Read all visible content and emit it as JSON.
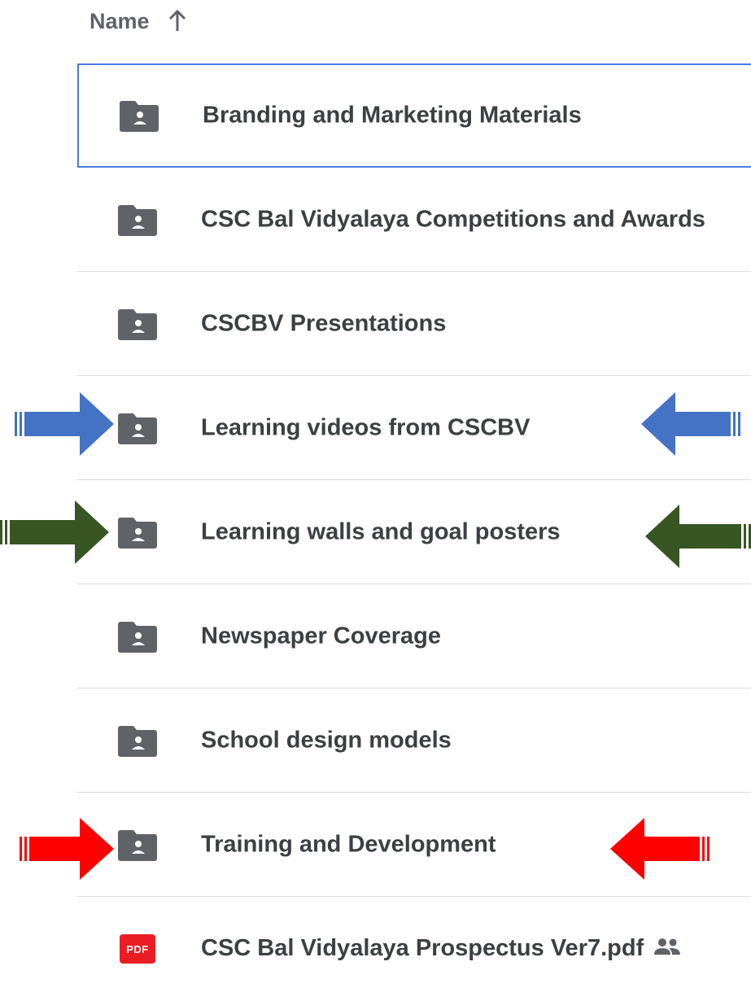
{
  "header": {
    "name_label": "Name",
    "sort_icon": "arrow-up-icon"
  },
  "files": [
    {
      "label": "Branding and Marketing Materials",
      "type": "shared-folder",
      "icon": "shared-folder-icon",
      "selected": true
    },
    {
      "label": "CSC Bal Vidyalaya Competitions and Awards",
      "type": "shared-folder",
      "icon": "shared-folder-icon",
      "selected": false
    },
    {
      "label": "CSCBV Presentations",
      "type": "shared-folder",
      "icon": "shared-folder-icon",
      "selected": false
    },
    {
      "label": "Learning videos from CSCBV",
      "type": "shared-folder",
      "icon": "shared-folder-icon",
      "selected": false
    },
    {
      "label": "Learning walls and goal posters",
      "type": "shared-folder",
      "icon": "shared-folder-icon",
      "selected": false
    },
    {
      "label": "Newspaper Coverage",
      "type": "shared-folder",
      "icon": "shared-folder-icon",
      "selected": false
    },
    {
      "label": "School design models",
      "type": "shared-folder",
      "icon": "shared-folder-icon",
      "selected": false
    },
    {
      "label": "Training and Development",
      "type": "shared-folder",
      "icon": "shared-folder-icon",
      "selected": false
    },
    {
      "label": "CSC Bal Vidyalaya Prospectus Ver7.pdf",
      "type": "pdf",
      "icon": "pdf-icon",
      "badge_text": "PDF",
      "shared_icon": "people-icon",
      "selected": false
    }
  ],
  "annotations": {
    "colors": {
      "blue": "#4472c4",
      "green": "#375623",
      "red": "#ff0000"
    },
    "arrows": [
      {
        "row": "Learning videos from CSCBV",
        "color": "blue",
        "sides": [
          "left",
          "right"
        ]
      },
      {
        "row": "Learning walls and goal posters",
        "color": "green",
        "sides": [
          "left",
          "right"
        ]
      },
      {
        "row": "Training and Development",
        "color": "red",
        "sides": [
          "left",
          "right"
        ]
      }
    ]
  },
  "colors": {
    "folder_icon": "#5f6368",
    "selected_border": "#4979e0",
    "divider": "#dadce0",
    "pdf_red": "#ea1d24"
  }
}
